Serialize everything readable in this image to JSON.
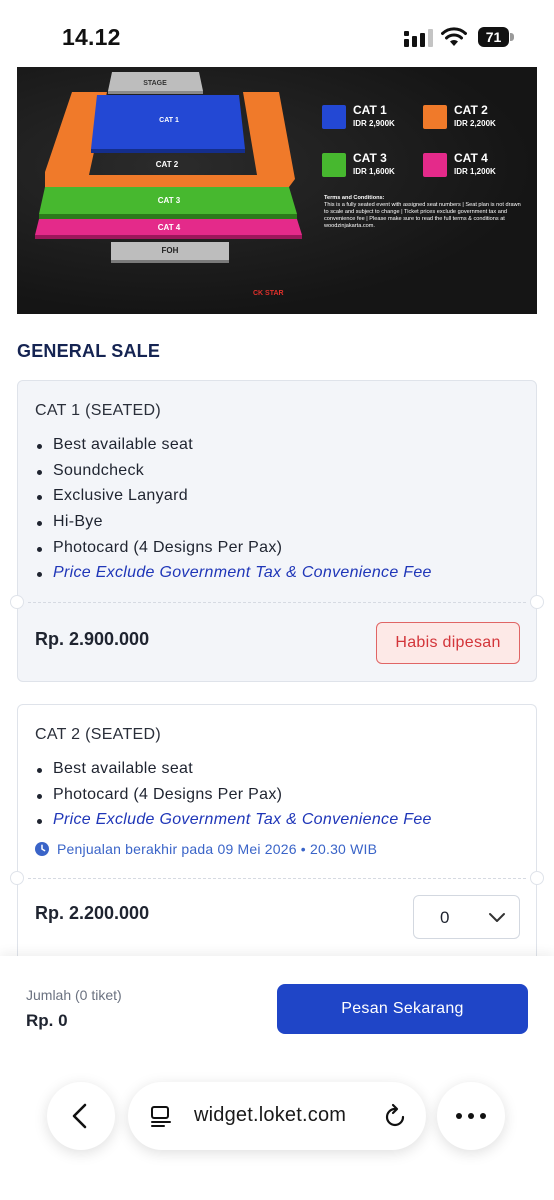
{
  "status_bar": {
    "time": "14.12",
    "battery": "71"
  },
  "seat_map": {
    "sections": {
      "stage": "STAGE",
      "cat1": "CAT 1",
      "cat2": "CAT 2",
      "cat3": "CAT 3",
      "cat4": "CAT 4",
      "foh": "FOH"
    },
    "legend": [
      {
        "name": "CAT 1",
        "price": "IDR 2,900K",
        "color": "#2348d4"
      },
      {
        "name": "CAT 2",
        "price": "IDR 2,200K",
        "color": "#f07a2a"
      },
      {
        "name": "CAT 3",
        "price": "IDR 1,600K",
        "color": "#47b82f"
      },
      {
        "name": "CAT 4",
        "price": "IDR 1,200K",
        "color": "#e42a8a"
      }
    ],
    "terms_title": "Terms and Conditions:",
    "terms_text": "This is a fully seated event with assigned seat numbers | Seat plan is not drawn to scale and subject to change | Ticket prices exclude government tax and convenience fee | Please make sure to read the full terms & conditions at woodzinjakarta.com.",
    "logo_text": "CK STAR"
  },
  "section_title": "GENERAL SALE",
  "tickets": [
    {
      "title": "CAT 1 (SEATED)",
      "benefits": [
        "Best available seat",
        "Soundcheck",
        "Exclusive Lanyard",
        "Hi-Bye",
        "Photocard (4 Designs Per Pax)"
      ],
      "note": "Price Exclude Government Tax & Convenience Fee",
      "price": "Rp. 2.900.000",
      "status": "Habis dipesan"
    },
    {
      "title": "CAT 2 (SEATED)",
      "benefits": [
        "Best available seat",
        "Photocard (4 Designs Per Pax)"
      ],
      "note": "Price Exclude Government Tax & Convenience Fee",
      "sale_end": "Penjualan berakhir pada 09 Mei 2026 • 20.30 WIB",
      "price": "Rp. 2.200.000",
      "quantity": "0"
    }
  ],
  "order_bar": {
    "quantity_label": "Jumlah (0 tiket)",
    "total": "Rp. 0",
    "order_button": "Pesan Sekarang"
  },
  "browser": {
    "url": "widget.loket.com",
    "icons": [
      "back-arrow-icon",
      "reader-icon",
      "reload-icon",
      "more-icon"
    ]
  }
}
